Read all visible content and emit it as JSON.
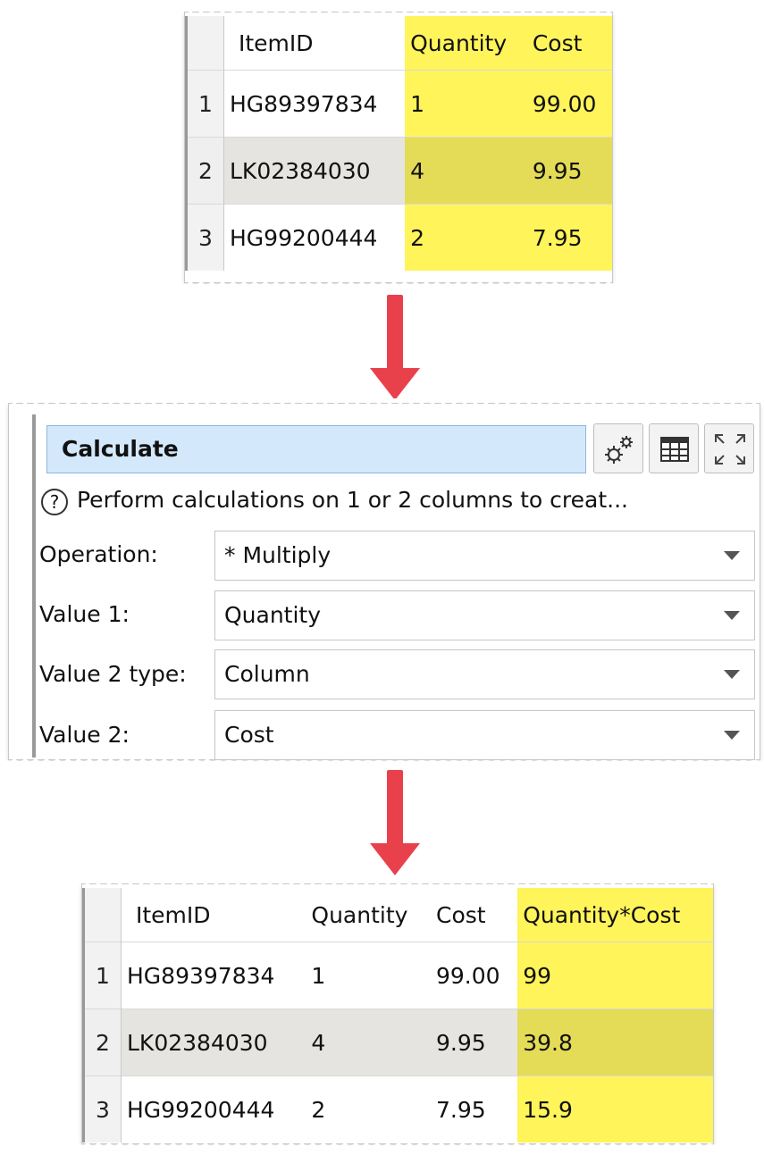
{
  "input_table": {
    "columns": [
      "ItemID",
      "Quantity",
      "Cost"
    ],
    "rows": [
      {
        "num": "1",
        "cells": [
          "HG89397834",
          "1",
          "99.00"
        ]
      },
      {
        "num": "2",
        "cells": [
          "LK02384030",
          "4",
          "9.95"
        ]
      },
      {
        "num": "3",
        "cells": [
          "HG99200444",
          "2",
          "7.95"
        ]
      }
    ]
  },
  "calculate_panel": {
    "title": "Calculate",
    "help_icon": "?",
    "description": "Perform calculations on 1 or 2 columns to creat...",
    "fields": [
      {
        "label": "Operation:",
        "value": "* Multiply"
      },
      {
        "label": "Value 1:",
        "value": "Quantity"
      },
      {
        "label": "Value 2 type:",
        "value": "Column"
      },
      {
        "label": "Value 2:",
        "value": "Cost"
      }
    ],
    "icons": [
      "gears-icon",
      "table-view-icon",
      "maximize-icon"
    ]
  },
  "output_table": {
    "columns": [
      "ItemID",
      "Quantity",
      "Cost",
      "Quantity*Cost"
    ],
    "rows": [
      {
        "num": "1",
        "cells": [
          "HG89397834",
          "1",
          "99.00",
          "99"
        ]
      },
      {
        "num": "2",
        "cells": [
          "LK02384030",
          "4",
          "9.95",
          "39.8"
        ]
      },
      {
        "num": "3",
        "cells": [
          "HG99200444",
          "2",
          "7.95",
          "15.9"
        ]
      }
    ]
  },
  "colors": {
    "highlight": "#fff45a",
    "arrow": "#e8414c",
    "title_bar": "#d3e8fb"
  }
}
